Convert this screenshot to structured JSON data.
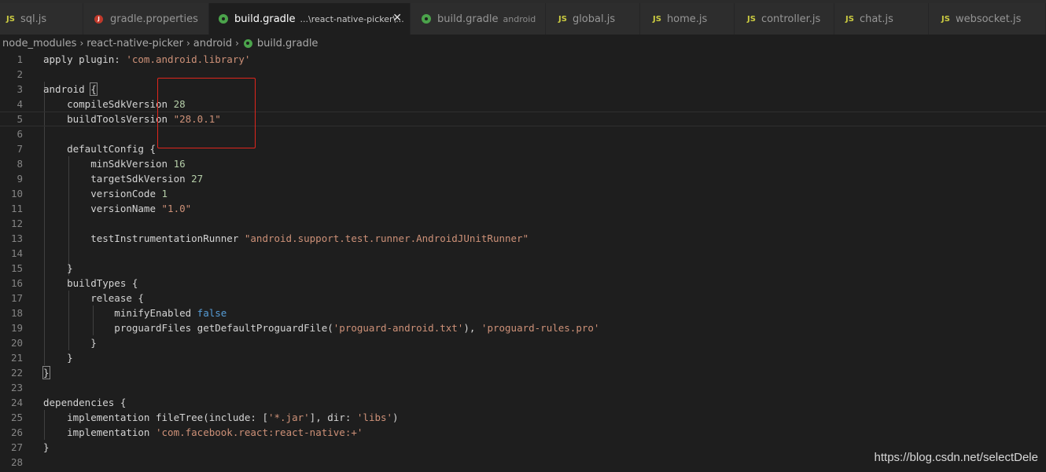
{
  "tabs": [
    {
      "icon": "js-icon",
      "label": "sql.js",
      "desc": "",
      "active": false
    },
    {
      "icon": "java-properties-icon",
      "label": "gradle.properties",
      "desc": "",
      "active": false
    },
    {
      "icon": "gradle-icon",
      "label": "build.gradle",
      "desc": "...\\react-native-picker\\...",
      "active": true,
      "close": "✕"
    },
    {
      "icon": "gradle-icon",
      "label": "build.gradle",
      "desc": "android",
      "active": false
    },
    {
      "icon": "js-icon",
      "label": "global.js",
      "desc": "",
      "active": false
    },
    {
      "icon": "js-icon",
      "label": "home.js",
      "desc": "",
      "active": false
    },
    {
      "icon": "js-icon",
      "label": "controller.js",
      "desc": "",
      "active": false
    },
    {
      "icon": "js-icon",
      "label": "chat.js",
      "desc": "",
      "active": false
    },
    {
      "icon": "js-icon",
      "label": "websocket.js",
      "desc": "",
      "active": false
    }
  ],
  "icon_glyphs": {
    "js": "JS",
    "properties": "J"
  },
  "breadcrumb": [
    "node_modules",
    "react-native-picker",
    "android",
    "build.gradle"
  ],
  "code_lines": [
    {
      "n": "1",
      "t": [
        [
          "apply plugin: ",
          ""
        ],
        [
          "'com.android.library'",
          "s"
        ]
      ]
    },
    {
      "n": "2",
      "t": []
    },
    {
      "n": "3",
      "t": [
        [
          "android ",
          ""
        ],
        [
          "{",
          "bm"
        ]
      ]
    },
    {
      "n": "4",
      "t": [
        [
          "    compileSdkVersion ",
          ""
        ],
        [
          "28",
          "n"
        ]
      ]
    },
    {
      "n": "5",
      "t": [
        [
          "    buildToolsVersion ",
          ""
        ],
        [
          "\"28.0.1\"",
          "s"
        ]
      ]
    },
    {
      "n": "6",
      "t": []
    },
    {
      "n": "7",
      "t": [
        [
          "    defaultConfig {",
          ""
        ]
      ]
    },
    {
      "n": "8",
      "t": [
        [
          "        minSdkVersion ",
          ""
        ],
        [
          "16",
          "n"
        ]
      ]
    },
    {
      "n": "9",
      "t": [
        [
          "        targetSdkVersion ",
          ""
        ],
        [
          "27",
          "n"
        ]
      ]
    },
    {
      "n": "10",
      "t": [
        [
          "        versionCode ",
          ""
        ],
        [
          "1",
          "n"
        ]
      ]
    },
    {
      "n": "11",
      "t": [
        [
          "        versionName ",
          ""
        ],
        [
          "\"1.0\"",
          "s"
        ]
      ]
    },
    {
      "n": "12",
      "t": []
    },
    {
      "n": "13",
      "t": [
        [
          "        testInstrumentationRunner ",
          ""
        ],
        [
          "\"android.support.test.runner.AndroidJUnitRunner\"",
          "s"
        ]
      ]
    },
    {
      "n": "14",
      "t": []
    },
    {
      "n": "15",
      "t": [
        [
          "    }",
          ""
        ]
      ]
    },
    {
      "n": "16",
      "t": [
        [
          "    buildTypes {",
          ""
        ]
      ]
    },
    {
      "n": "17",
      "t": [
        [
          "        release {",
          ""
        ]
      ]
    },
    {
      "n": "18",
      "t": [
        [
          "            minifyEnabled ",
          ""
        ],
        [
          "false",
          "kw"
        ]
      ]
    },
    {
      "n": "19",
      "t": [
        [
          "            proguardFiles getDefaultProguardFile(",
          ""
        ],
        [
          "'proguard-android.txt'",
          "s"
        ],
        [
          "), ",
          ""
        ],
        [
          "'proguard-rules.pro'",
          "s"
        ]
      ]
    },
    {
      "n": "20",
      "t": [
        [
          "        }",
          ""
        ]
      ]
    },
    {
      "n": "21",
      "t": [
        [
          "    }",
          ""
        ]
      ]
    },
    {
      "n": "22",
      "t": [
        [
          "}",
          "bm"
        ]
      ]
    },
    {
      "n": "23",
      "t": []
    },
    {
      "n": "24",
      "t": [
        [
          "dependencies {",
          ""
        ]
      ]
    },
    {
      "n": "25",
      "t": [
        [
          "    implementation fileTree(include: [",
          ""
        ],
        [
          "'*.jar'",
          "s"
        ],
        [
          "], dir: ",
          ""
        ],
        [
          "'libs'",
          "s"
        ],
        [
          ")",
          ""
        ]
      ]
    },
    {
      "n": "26",
      "t": [
        [
          "    implementation ",
          ""
        ],
        [
          "'com.facebook.react:react-native:+'",
          "s"
        ]
      ]
    },
    {
      "n": "27",
      "t": [
        [
          "}",
          ""
        ]
      ]
    },
    {
      "n": "28",
      "t": []
    }
  ],
  "current_line": "5",
  "watermark": "https://blog.csdn.net/selectDele"
}
